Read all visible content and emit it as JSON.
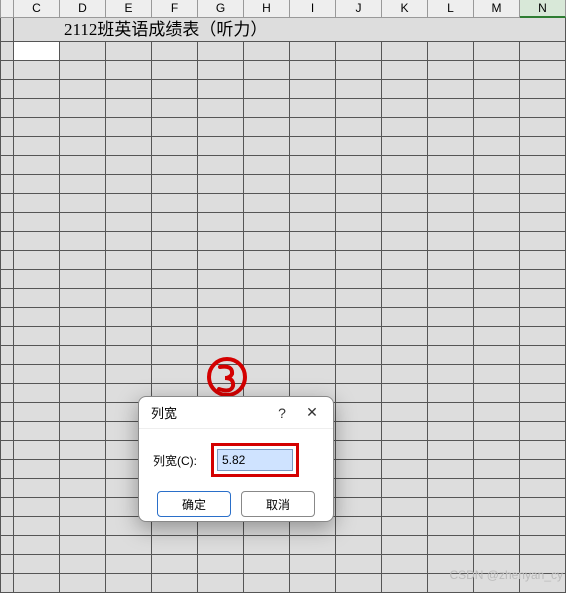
{
  "columns": [
    "C",
    "D",
    "E",
    "F",
    "G",
    "H",
    "I",
    "J",
    "K",
    "L",
    "M",
    "N"
  ],
  "selected_col": "N",
  "title": "2112班英语成绩表（听力）",
  "dialog": {
    "title": "列宽",
    "label": "列宽(C):",
    "value": "5.82",
    "ok": "确定",
    "cancel": "取消",
    "help_symbol": "?",
    "close_symbol": "✕"
  },
  "annotation": {
    "label": "3"
  },
  "watermark": "CSDN @zhenyan_cy",
  "grid": {
    "row_count": 29
  }
}
